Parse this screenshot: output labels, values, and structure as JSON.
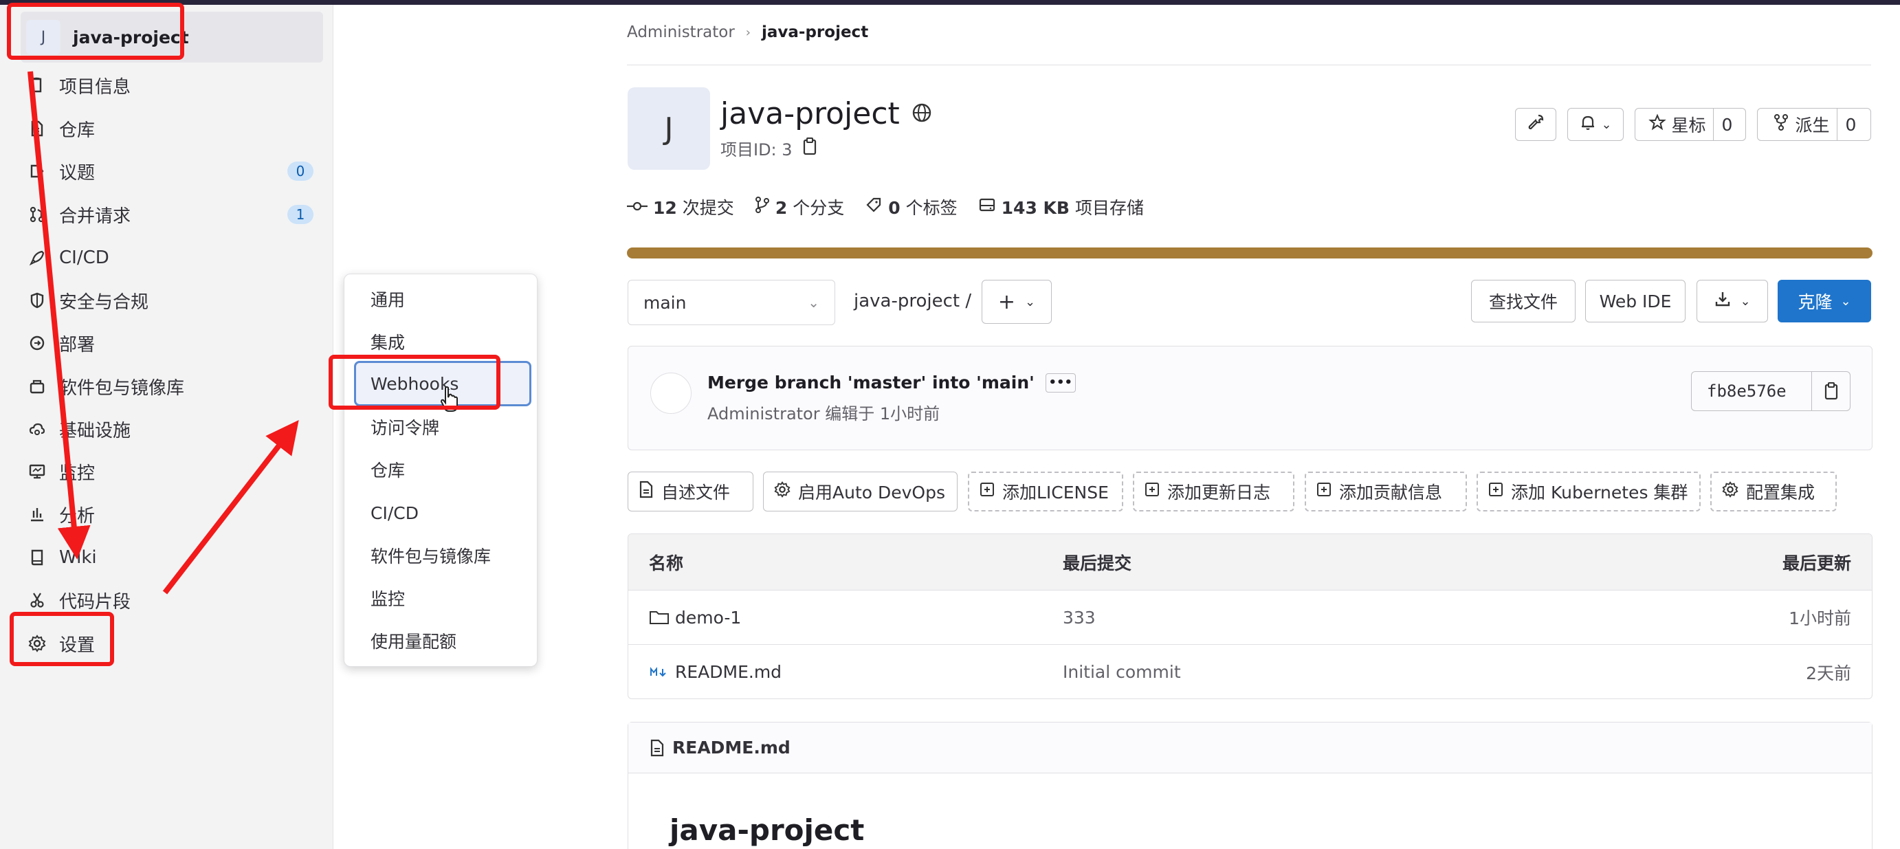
{
  "sidebar": {
    "project": {
      "avatar_letter": "J",
      "name": "java-project"
    },
    "items": [
      {
        "label": "项目信息",
        "icon": "info-icon"
      },
      {
        "label": "仓库",
        "icon": "document-icon"
      },
      {
        "label": "议题",
        "icon": "issues-icon",
        "count": "0"
      },
      {
        "label": "合并请求",
        "icon": "merge-request-icon",
        "count": "1"
      },
      {
        "label": "CI/CD",
        "icon": "rocket-icon"
      },
      {
        "label": "安全与合规",
        "icon": "shield-icon"
      },
      {
        "label": "部署",
        "icon": "deploy-icon"
      },
      {
        "label": "软件包与镜像库",
        "icon": "package-icon"
      },
      {
        "label": "基础设施",
        "icon": "cloud-gear-icon"
      },
      {
        "label": "监控",
        "icon": "monitor-icon"
      },
      {
        "label": "分析",
        "icon": "chart-icon"
      },
      {
        "label": "Wiki",
        "icon": "book-icon"
      },
      {
        "label": "代码片段",
        "icon": "scissors-icon"
      },
      {
        "label": "设置",
        "icon": "gear-icon"
      }
    ]
  },
  "flyout": {
    "items": [
      "通用",
      "集成",
      "Webhooks",
      "访问令牌",
      "仓库",
      "CI/CD",
      "软件包与镜像库",
      "监控",
      "使用量配额"
    ],
    "hovered": "Webhooks"
  },
  "breadcrumb": {
    "parent": "Administrator",
    "current": "java-project"
  },
  "project": {
    "avatar_letter": "J",
    "title": "java-project",
    "id_label": "项目ID: 3",
    "star_label": "星标",
    "star_count": "0",
    "fork_label": "派生",
    "fork_count": "0"
  },
  "stats": {
    "commits_num": "12",
    "commits_label": "次提交",
    "branches_num": "2",
    "branches_label": "个分支",
    "tags_num": "0",
    "tags_label": "个标签",
    "storage_num": "143 KB",
    "storage_label": "项目存储"
  },
  "repo_bar": {
    "branch": "main",
    "path": "java-project  /",
    "find_file": "查找文件",
    "web_ide": "Web IDE",
    "clone": "克隆"
  },
  "commit": {
    "message": "Merge branch 'master' into 'main'",
    "author_line": "Administrator 编辑于 1小时前",
    "sha": "fb8e576e"
  },
  "quick_actions": [
    "自述文件",
    "启用Auto DevOps",
    "添加LICENSE",
    "添加更新日志",
    "添加贡献信息",
    "添加 Kubernetes 集群",
    "配置集成"
  ],
  "files": {
    "headers": [
      "名称",
      "最后提交",
      "最后更新"
    ],
    "rows": [
      {
        "name": "demo-1",
        "commit": "333",
        "updated": "1小时前",
        "icon": "folder-icon"
      },
      {
        "name": "README.md",
        "commit": "Initial commit",
        "updated": "2天前",
        "icon": "markdown-icon"
      }
    ]
  },
  "readme": {
    "file": "README.md",
    "heading": "java-project"
  },
  "colors": {
    "accent": "#1f75cb",
    "annotation": "#f21a1a",
    "storage_bar": "#a67c36"
  }
}
